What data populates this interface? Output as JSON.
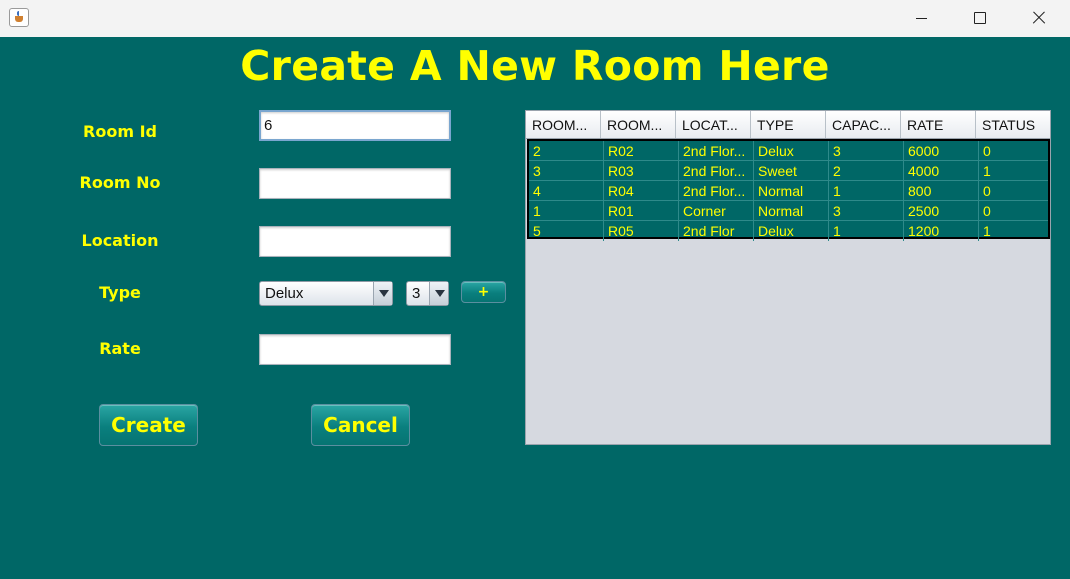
{
  "window": {
    "icon": "java-cup-icon"
  },
  "title": "Create A New Room Here",
  "form": {
    "room_id": {
      "label": "Room Id",
      "value": "6"
    },
    "room_no": {
      "label": "Room No",
      "value": ""
    },
    "location": {
      "label": "Location",
      "value": ""
    },
    "type": {
      "label": "Type",
      "selected": "Delux",
      "capacity_selected": "3",
      "add_label": "+"
    },
    "rate": {
      "label": "Rate",
      "value": ""
    }
  },
  "buttons": {
    "create": "Create",
    "cancel": "Cancel"
  },
  "table": {
    "columns": [
      "ROOM...",
      "ROOM...",
      "LOCAT...",
      "TYPE",
      "CAPAC...",
      "RATE",
      "STATUS"
    ],
    "rows": [
      [
        "2",
        "R02",
        "2nd Flor...",
        "Delux",
        "3",
        "6000",
        "0"
      ],
      [
        "3",
        "R03",
        "2nd Flor...",
        "Sweet",
        "2",
        "4000",
        "1"
      ],
      [
        "4",
        "R04",
        "2nd Flor...",
        "Normal",
        "1",
        "800",
        "0"
      ],
      [
        "1",
        "R01",
        "Corner",
        "Normal",
        "3",
        "2500",
        "0"
      ],
      [
        "5",
        "R05",
        "2nd Flor",
        "Delux",
        "1",
        "1200",
        "1"
      ]
    ]
  },
  "colors": {
    "background": "#006766",
    "accent_text": "#ffff00"
  }
}
